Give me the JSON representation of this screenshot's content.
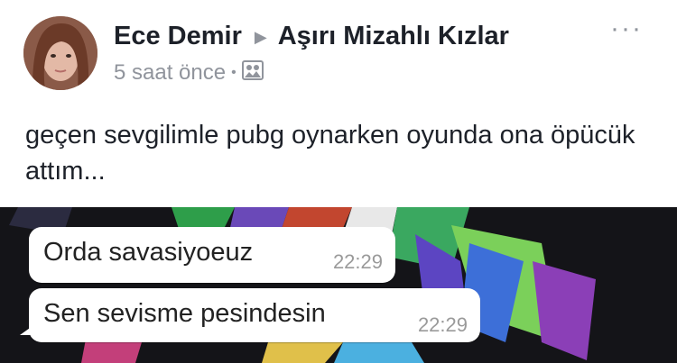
{
  "header": {
    "author": "Ece Demir",
    "group": "Aşırı Mizahlı Kızlar",
    "timestamp": "5 saat önce",
    "separator": "•",
    "privacy_icon": "photo-icon",
    "more_label": "···"
  },
  "post": {
    "text": "geçen sevgilimle pubg oynarken oyunda ona öpücük attım..."
  },
  "screenshot": {
    "messages": [
      {
        "text": "Orda savasiyoeuz",
        "time": "22:29"
      },
      {
        "text": "Sen sevisme pesindesin",
        "time": "22:29"
      }
    ]
  }
}
